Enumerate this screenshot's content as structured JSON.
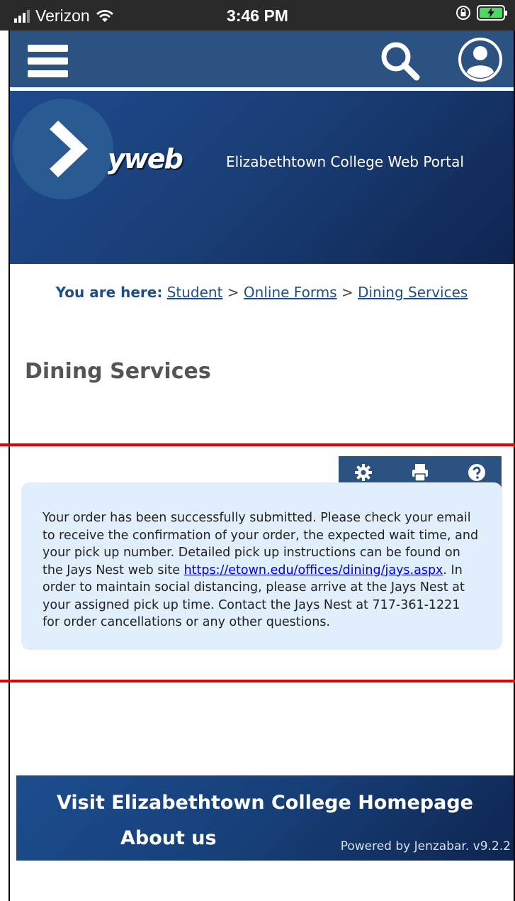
{
  "status_bar": {
    "carrier": "Verizon",
    "time": "3:46 PM",
    "battery_color": "#4cd964"
  },
  "nav": {
    "menu_icon": "hamburger-menu-icon",
    "search_icon": "search-icon",
    "profile_icon": "user-profile-icon",
    "bg_color": "#2c5282"
  },
  "banner": {
    "logo_text": "yweb",
    "title": "Elizabethtown College Web Portal"
  },
  "breadcrumb": {
    "lead": "You are here:",
    "items": [
      "Student",
      "Online Forms",
      "Dining Services"
    ],
    "separator": ">"
  },
  "page": {
    "title": "Dining Services"
  },
  "toolbar": {
    "icons": [
      "gear-icon",
      "print-icon",
      "help-icon"
    ]
  },
  "message": {
    "text_before": "Your order has been successfully submitted. Please check your email to receive the confirmation of your order, the expected wait time, and your pick up number. Detailed pick up instructions can be found on the Jays Nest web site",
    "link": "https://etown.edu/offices/dining/jays.aspx",
    "text_after": ". In order to maintain social distancing, please arrive at the Jays Nest at your assigned pick up time. Contact the Jays Nest at 717-361-1221 for order cancellations or any other questions."
  },
  "footer": {
    "link_homepage": "Visit Elizabethtown College Homepage",
    "link_about": "About us",
    "powered_by": "Powered by Jenzabar. v9.2.2"
  },
  "colors": {
    "accent": "#2c5282",
    "highlight_line": "#e60000",
    "message_bg": "#e1eefb"
  }
}
